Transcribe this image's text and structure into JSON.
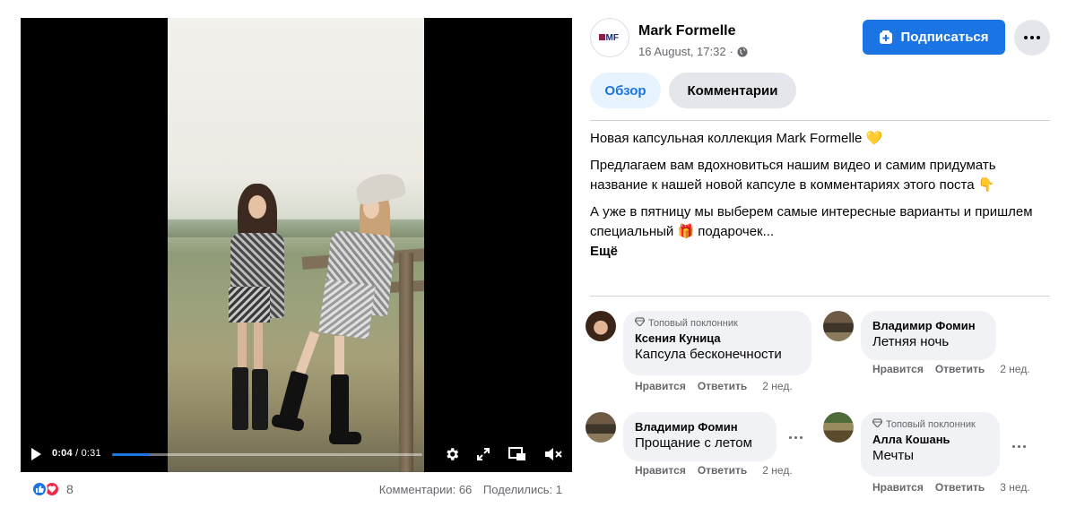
{
  "video": {
    "current_time": "0:04",
    "duration": "0:31",
    "progress_fraction": 0.12
  },
  "reactions": {
    "count": "8",
    "comments": "Комментарии: 66",
    "shares": "Поделились: 1"
  },
  "post": {
    "page_name": "Mark Formelle",
    "avatar_text": "MF",
    "date": "16 August, 17:32",
    "separator": "·",
    "subscribe_label": "Подписаться",
    "tabs": [
      "Обзор",
      "Комментарии"
    ],
    "paragraphs": [
      "Новая капсульная коллекция Mark Formelle 💛",
      "Предлагаем вам вдохновиться нашим видео и самим придумать название к нашей новой капсуле в комментариях этого поста 👇",
      "А уже в пятницу мы выберем самые интересные варианты и пришлем специальный 🎁 подарочек..."
    ],
    "see_more": "Ещё"
  },
  "comments": [
    {
      "badge": "Топовый поклонник",
      "author": "Ксения Куница",
      "text": "Капсула бесконечности",
      "like": "Нравится",
      "reply": "Ответить",
      "ago": "2 нед."
    },
    {
      "badge": "",
      "author": "Владимир Фомин",
      "text": "Летняя ночь",
      "like": "Нравится",
      "reply": "Ответить",
      "ago": "2 нед."
    },
    {
      "badge": "",
      "author": "Владимир Фомин",
      "text": "Прощание с летом",
      "like": "Нравится",
      "reply": "Ответить",
      "ago": "2 нед."
    },
    {
      "badge": "Топовый поклонник",
      "author": "Алла Кошань",
      "text": "Мечты",
      "like": "Нравится",
      "reply": "Ответить",
      "ago": "3 нед."
    }
  ],
  "colors": {
    "accent": "#1b74e4",
    "love": "#f02849",
    "secondary_text": "#65676b"
  }
}
